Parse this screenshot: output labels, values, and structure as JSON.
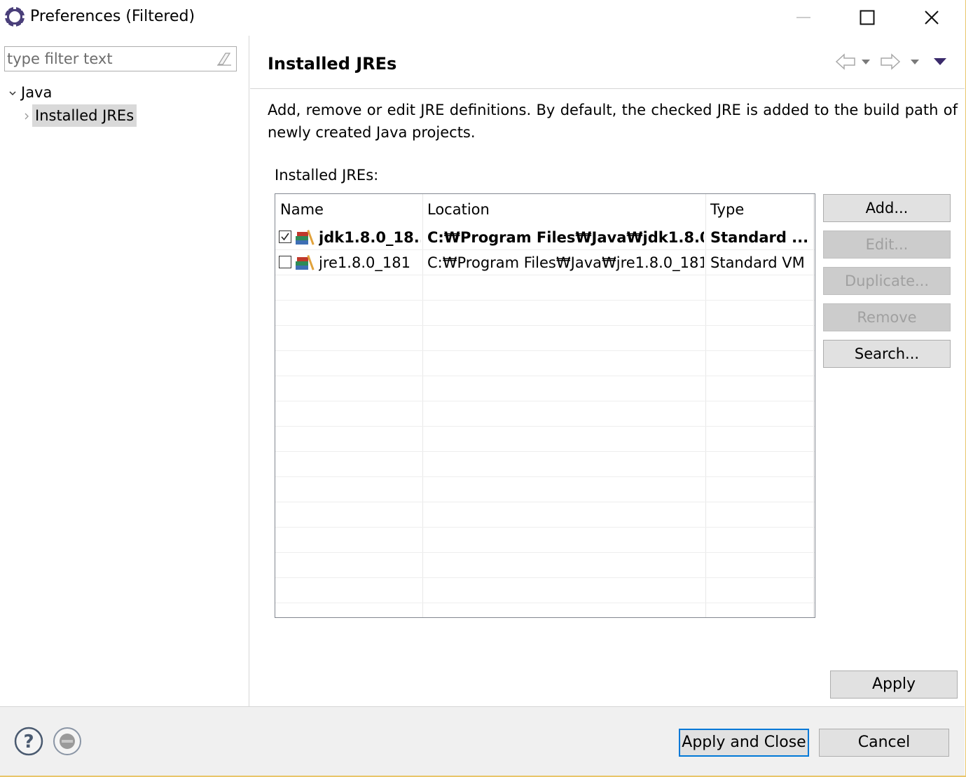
{
  "window": {
    "title": "Preferences (Filtered)",
    "border_color": "#e8c56a"
  },
  "sidebar": {
    "filter_placeholder": "type filter text",
    "filter_value": "",
    "tree": [
      {
        "label": "Java",
        "expanded": true
      },
      {
        "label": "Installed JREs",
        "selected": true
      }
    ]
  },
  "page": {
    "title": "Installed JREs",
    "description": "Add, remove or edit JRE definitions. By default, the checked JRE is added to the build path of newly created Java projects.",
    "group_label": "Installed JREs:",
    "table": {
      "columns": [
        "Name",
        "Location",
        "Type"
      ],
      "rows": [
        {
          "checked": true,
          "bold": true,
          "name": "jdk1.8.0_18...",
          "location": "C:₩Program Files₩Java₩jdk1.8.0...",
          "type": "Standard ..."
        },
        {
          "checked": false,
          "bold": false,
          "name": "jre1.8.0_181",
          "location": "C:₩Program Files₩Java₩jre1.8.0_181",
          "type": "Standard VM"
        }
      ]
    },
    "buttons": {
      "add": "Add...",
      "edit": "Edit...",
      "duplicate": "Duplicate...",
      "remove": "Remove",
      "search": "Search...",
      "apply": "Apply"
    },
    "nav_icons": [
      "back-arrow-icon",
      "dropdown-icon",
      "forward-arrow-icon",
      "dropdown-icon",
      "view-menu-icon"
    ]
  },
  "footer": {
    "apply_and_close": "Apply and Close",
    "cancel": "Cancel",
    "icons": [
      "help-icon",
      "record-icon"
    ]
  },
  "colors": {
    "selection_bg": "#d9d9d9",
    "button_bg": "#e1e1e1",
    "default_button_border": "#0078d7",
    "disabled_text": "#a0a0a0",
    "accent_purple": "#3a2a6b"
  }
}
